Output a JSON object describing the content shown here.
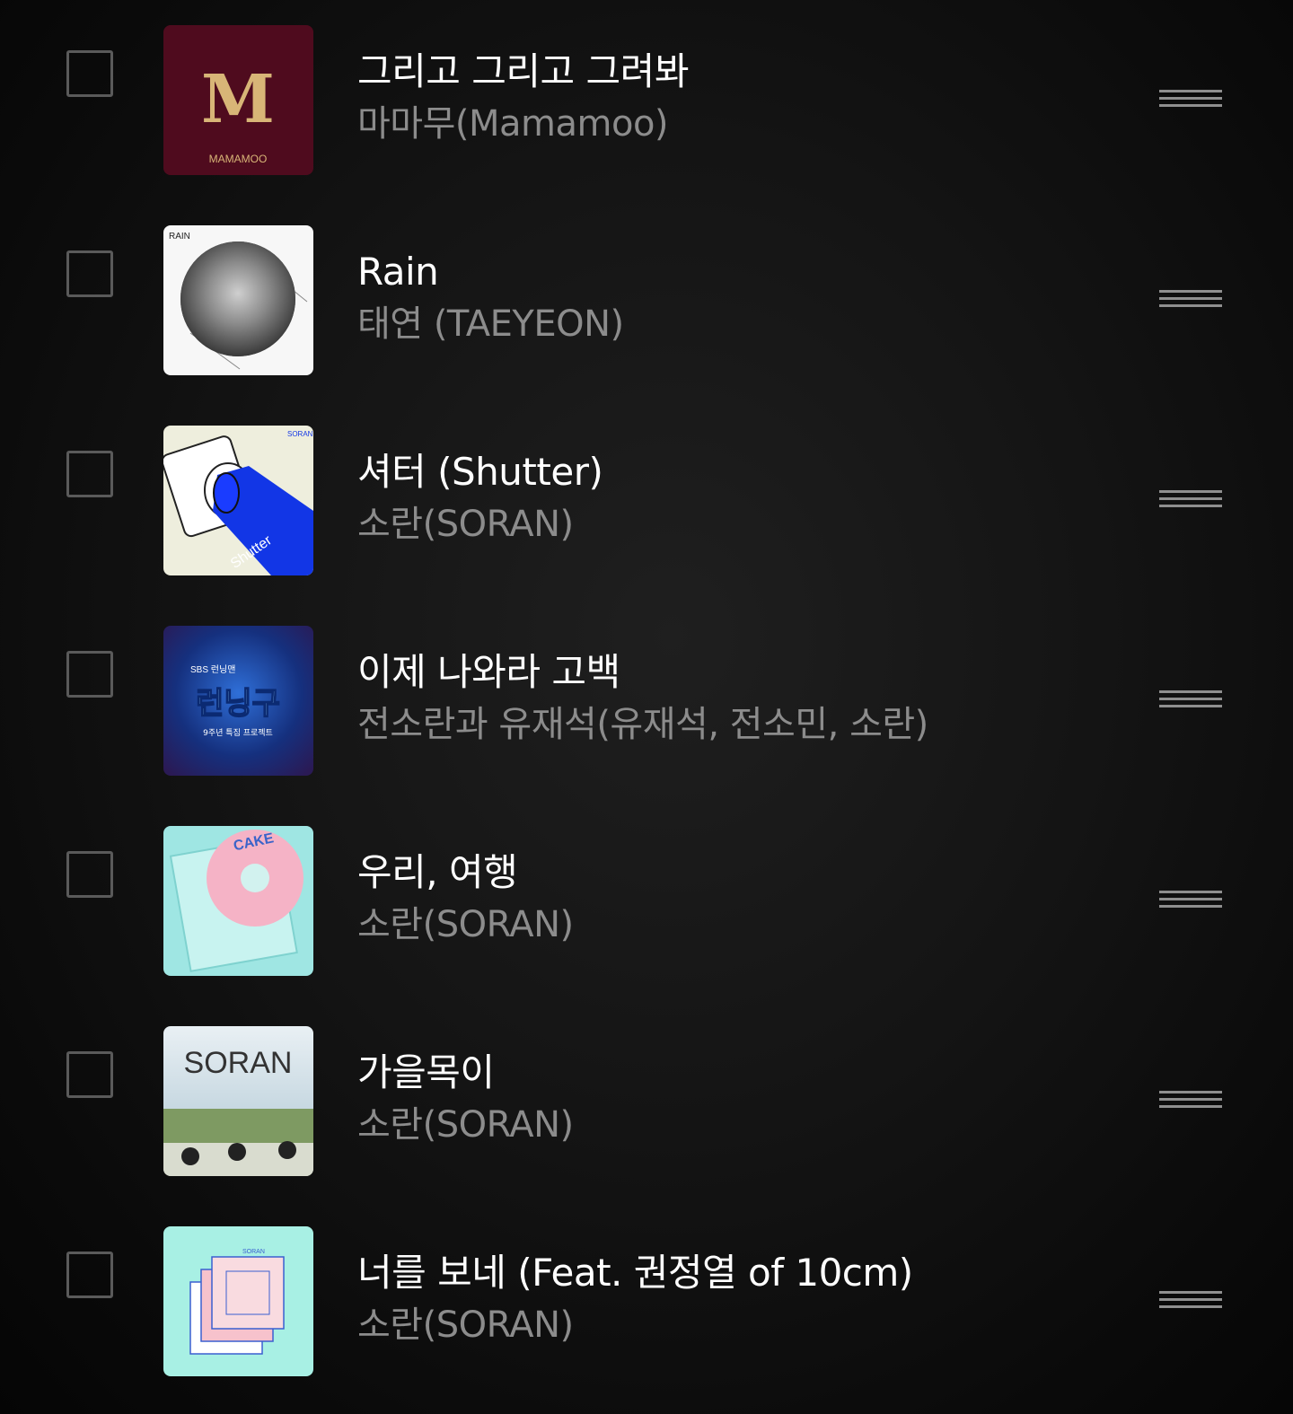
{
  "playlist": {
    "tracks": [
      {
        "title": "그리고 그리고 그려봐",
        "artist": "마마무(Mamamoo)",
        "art": {
          "brand_text": "MAMAMOO",
          "letter": "M"
        }
      },
      {
        "title": "Rain",
        "artist": "태연 (TAEYEON)",
        "art": {
          "brand_text": "RAIN"
        }
      },
      {
        "title": "셔터 (Shutter)",
        "artist": "소란(SORAN)",
        "art": {
          "brand_text": "SORAN",
          "word": "Shutter"
        }
      },
      {
        "title": "이제 나와라 고백",
        "artist": "전소란과 유재석(유재석, 전소민, 소란)",
        "art": {
          "brand_text": "SBS 런닝맨",
          "big": "런닝구",
          "sub": "9주년 특집 프로젝트"
        }
      },
      {
        "title": "우리, 여행",
        "artist": "소란(SORAN)",
        "art": {
          "brand_text": "CAKE"
        }
      },
      {
        "title": "가을목이",
        "artist": "소란(SORAN)",
        "art": {
          "brand_text": "SORAN"
        }
      },
      {
        "title": "너를 보네 (Feat. 권정열 of 10cm)",
        "artist": "소란(SORAN)",
        "art": {
          "brand_text": "SORAN"
        }
      }
    ]
  },
  "colors": {
    "title": "#ffffff",
    "artist": "#8c8c8c",
    "checkbox_border": "#5a5a5a",
    "drag_handle": "#8f8f8f"
  },
  "icons": {
    "checkbox": "checkbox-unchecked-icon",
    "drag": "drag-handle-icon"
  }
}
